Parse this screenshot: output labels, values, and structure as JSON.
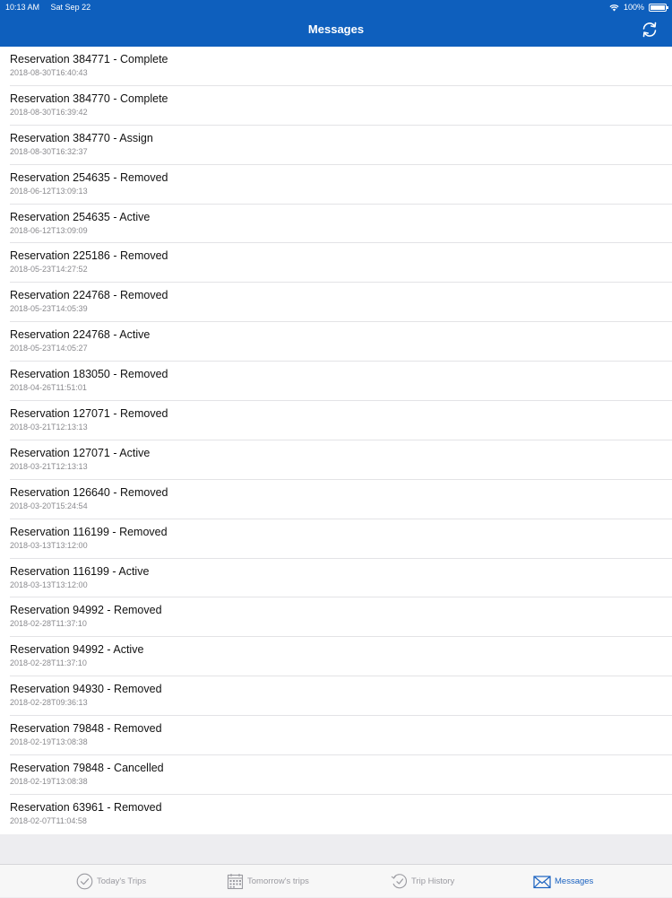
{
  "status_bar": {
    "time": "10:13 AM",
    "date": "Sat Sep 22",
    "battery": "100%"
  },
  "header": {
    "title": "Messages"
  },
  "messages": [
    {
      "title": "Reservation 384771 - Complete",
      "time": "2018-08-30T16:40:43"
    },
    {
      "title": "Reservation 384770 - Complete",
      "time": "2018-08-30T16:39:42"
    },
    {
      "title": "Reservation 384770 - Assign",
      "time": "2018-08-30T16:32:37"
    },
    {
      "title": "Reservation 254635 - Removed",
      "time": "2018-06-12T13:09:13"
    },
    {
      "title": "Reservation 254635 - Active",
      "time": "2018-06-12T13:09:09"
    },
    {
      "title": "Reservation 225186 - Removed",
      "time": "2018-05-23T14:27:52"
    },
    {
      "title": "Reservation 224768 - Removed",
      "time": "2018-05-23T14:05:39"
    },
    {
      "title": "Reservation 224768 - Active",
      "time": "2018-05-23T14:05:27"
    },
    {
      "title": "Reservation 183050 - Removed",
      "time": "2018-04-26T11:51:01"
    },
    {
      "title": "Reservation 127071 - Removed",
      "time": "2018-03-21T12:13:13"
    },
    {
      "title": "Reservation 127071 - Active",
      "time": "2018-03-21T12:13:13"
    },
    {
      "title": "Reservation 126640 - Removed",
      "time": "2018-03-20T15:24:54"
    },
    {
      "title": "Reservation 116199 - Removed",
      "time": "2018-03-13T13:12:00"
    },
    {
      "title": "Reservation 116199 - Active",
      "time": "2018-03-13T13:12:00"
    },
    {
      "title": "Reservation 94992 - Removed",
      "time": "2018-02-28T11:37:10"
    },
    {
      "title": "Reservation 94992 - Active",
      "time": "2018-02-28T11:37:10"
    },
    {
      "title": "Reservation 94930 - Removed",
      "time": "2018-02-28T09:36:13"
    },
    {
      "title": "Reservation 79848 - Removed",
      "time": "2018-02-19T13:08:38"
    },
    {
      "title": "Reservation 79848 - Cancelled",
      "time": "2018-02-19T13:08:38"
    },
    {
      "title": "Reservation 63961 - Removed",
      "time": "2018-02-07T11:04:58"
    }
  ],
  "tabs": [
    {
      "label": "Today's Trips",
      "icon": "check-circle-icon",
      "active": false
    },
    {
      "label": "Tomorrow's trips",
      "icon": "calendar-icon",
      "active": false
    },
    {
      "label": "Trip History",
      "icon": "history-icon",
      "active": false
    },
    {
      "label": "Messages",
      "icon": "envelope-icon",
      "active": true
    }
  ],
  "colors": {
    "header": "#0e5fbd",
    "active_tab": "#1a62c0",
    "inactive_tab": "#9a9aa0"
  }
}
